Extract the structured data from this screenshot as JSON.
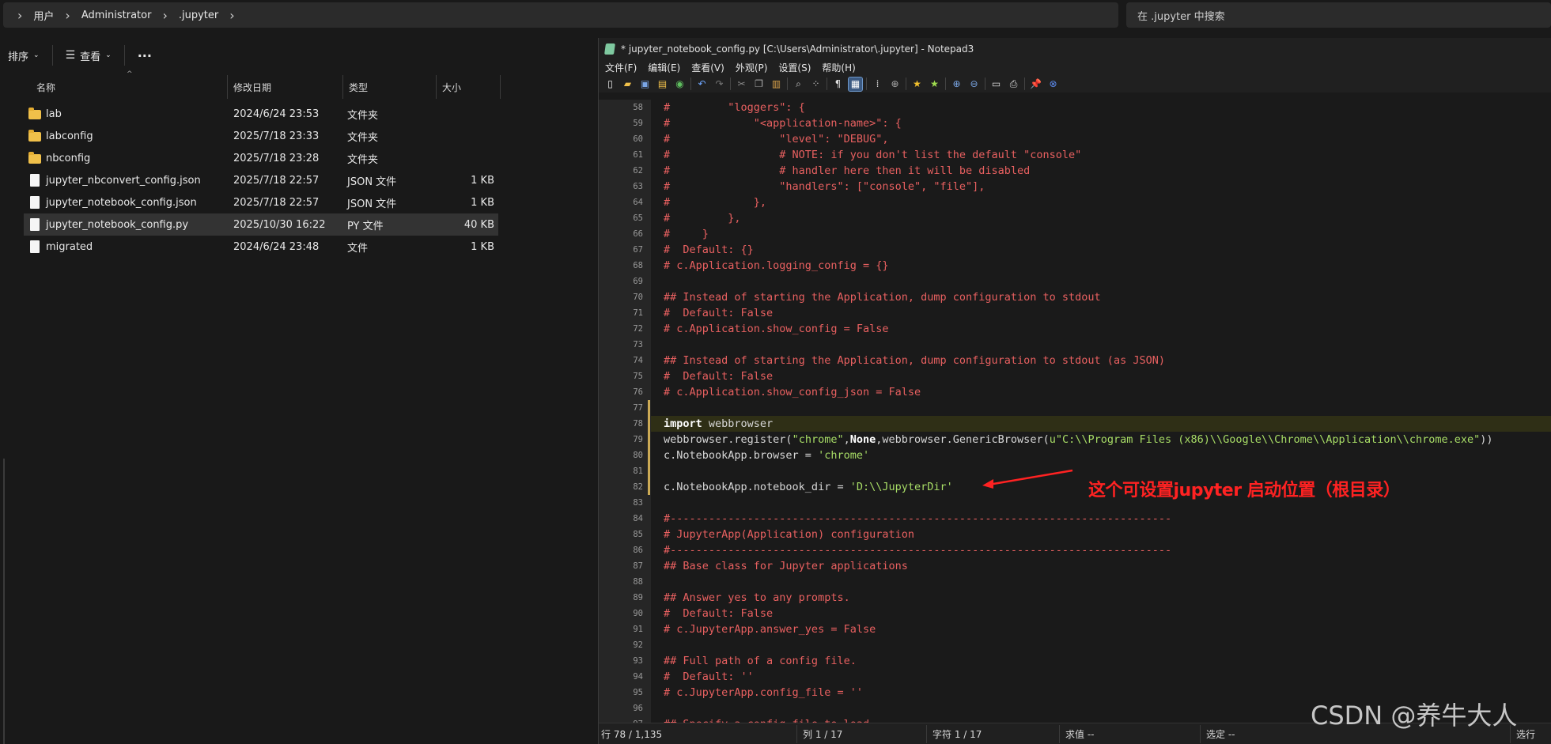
{
  "explorer": {
    "breadcrumbs": [
      "用户",
      "Administrator",
      ".jupyter"
    ],
    "search_placeholder": "在 .jupyter 中搜索",
    "commands": {
      "sort": "排序",
      "view": "查看",
      "more": "···"
    },
    "columns": {
      "name": "名称",
      "modified": "修改日期",
      "type": "类型",
      "size": "大小"
    },
    "files": [
      {
        "name": "lab",
        "modified": "2024/6/24 23:53",
        "type": "文件夹",
        "size": "",
        "icon": "folder-icon"
      },
      {
        "name": "labconfig",
        "modified": "2025/7/18 23:33",
        "type": "文件夹",
        "size": "",
        "icon": "folder-icon"
      },
      {
        "name": "nbconfig",
        "modified": "2025/7/18 23:28",
        "type": "文件夹",
        "size": "",
        "icon": "folder-icon"
      },
      {
        "name": "jupyter_nbconvert_config.json",
        "modified": "2025/7/18 22:57",
        "type": "JSON 文件",
        "size": "1 KB",
        "icon": "file-icon"
      },
      {
        "name": "jupyter_notebook_config.json",
        "modified": "2025/7/18 22:57",
        "type": "JSON 文件",
        "size": "1 KB",
        "icon": "file-icon"
      },
      {
        "name": "jupyter_notebook_config.py",
        "modified": "2025/10/30 16:22",
        "type": "PY 文件",
        "size": "40 KB",
        "icon": "file-icon",
        "selected": true
      },
      {
        "name": "migrated",
        "modified": "2024/6/24 23:48",
        "type": "文件",
        "size": "1 KB",
        "icon": "file-icon"
      }
    ]
  },
  "notepad": {
    "title": "* jupyter_notebook_config.py [C:\\Users\\Administrator\\.jupyter] - Notepad3",
    "menu": [
      "文件(F)",
      "编辑(E)",
      "查看(V)",
      "外观(P)",
      "设置(S)",
      "帮助(H)"
    ],
    "lines": [
      {
        "n": "58",
        "segs": [
          [
            "cm",
            "#         \"loggers\": {"
          ]
        ]
      },
      {
        "n": "59",
        "segs": [
          [
            "cm",
            "#             \"<application-name>\": {"
          ]
        ]
      },
      {
        "n": "60",
        "segs": [
          [
            "cm",
            "#                 \"level\": \"DEBUG\","
          ]
        ]
      },
      {
        "n": "61",
        "segs": [
          [
            "cm",
            "#                 # NOTE: if you don't list the default \"console\""
          ]
        ]
      },
      {
        "n": "62",
        "segs": [
          [
            "cm",
            "#                 # handler here then it will be disabled"
          ]
        ]
      },
      {
        "n": "63",
        "segs": [
          [
            "cm",
            "#                 \"handlers\": [\"console\", \"file\"],"
          ]
        ]
      },
      {
        "n": "64",
        "segs": [
          [
            "cm",
            "#             },"
          ]
        ]
      },
      {
        "n": "65",
        "segs": [
          [
            "cm",
            "#         },"
          ]
        ]
      },
      {
        "n": "66",
        "segs": [
          [
            "cm",
            "#     }"
          ]
        ]
      },
      {
        "n": "67",
        "segs": [
          [
            "cm",
            "#  Default: {}"
          ]
        ]
      },
      {
        "n": "68",
        "segs": [
          [
            "cm",
            "# c.Application.logging_config = {}"
          ]
        ]
      },
      {
        "n": "69",
        "segs": []
      },
      {
        "n": "70",
        "segs": [
          [
            "cm",
            "## Instead of starting the Application, dump configuration to stdout"
          ]
        ]
      },
      {
        "n": "71",
        "segs": [
          [
            "cm",
            "#  Default: False"
          ]
        ]
      },
      {
        "n": "72",
        "segs": [
          [
            "cm",
            "# c.Application.show_config = False"
          ]
        ]
      },
      {
        "n": "73",
        "segs": []
      },
      {
        "n": "74",
        "segs": [
          [
            "cm",
            "## Instead of starting the Application, dump configuration to stdout (as JSON)"
          ]
        ]
      },
      {
        "n": "75",
        "segs": [
          [
            "cm",
            "#  Default: False"
          ]
        ]
      },
      {
        "n": "76",
        "segs": [
          [
            "cm",
            "# c.Application.show_config_json = False"
          ]
        ]
      },
      {
        "n": "77",
        "segs": []
      },
      {
        "n": "78",
        "segs": [
          [
            "kw",
            "import"
          ],
          [
            "id",
            " webbrowser"
          ]
        ],
        "highlight": true
      },
      {
        "n": "79",
        "segs": [
          [
            "id",
            "webbrowser.register("
          ],
          [
            "str",
            "\"chrome\""
          ],
          [
            "id",
            ","
          ],
          [
            "kw",
            "None"
          ],
          [
            "id",
            ",webbrowser.GenericBrowser("
          ],
          [
            "str",
            "u\"C:\\\\Program Files (x86)\\\\Google\\\\Chrome\\\\Application\\\\chrome.exe\""
          ],
          [
            "id",
            "))"
          ]
        ]
      },
      {
        "n": "80",
        "segs": [
          [
            "id",
            "c.NotebookApp.browser = "
          ],
          [
            "str",
            "'chrome'"
          ]
        ]
      },
      {
        "n": "81",
        "segs": []
      },
      {
        "n": "82",
        "segs": [
          [
            "id",
            "c.NotebookApp.notebook_dir = "
          ],
          [
            "str",
            "'D:\\\\JupyterDir'"
          ]
        ]
      },
      {
        "n": "83",
        "segs": []
      },
      {
        "n": "84",
        "segs": [
          [
            "cm",
            "#------------------------------------------------------------------------------"
          ]
        ]
      },
      {
        "n": "85",
        "segs": [
          [
            "cm",
            "# JupyterApp(Application) configuration"
          ]
        ]
      },
      {
        "n": "86",
        "segs": [
          [
            "cm",
            "#------------------------------------------------------------------------------"
          ]
        ]
      },
      {
        "n": "87",
        "segs": [
          [
            "cm",
            "## Base class for Jupyter applications"
          ]
        ]
      },
      {
        "n": "88",
        "segs": []
      },
      {
        "n": "89",
        "segs": [
          [
            "cm",
            "## Answer yes to any prompts."
          ]
        ]
      },
      {
        "n": "90",
        "segs": [
          [
            "cm",
            "#  Default: False"
          ]
        ]
      },
      {
        "n": "91",
        "segs": [
          [
            "cm",
            "# c.JupyterApp.answer_yes = False"
          ]
        ]
      },
      {
        "n": "92",
        "segs": []
      },
      {
        "n": "93",
        "segs": [
          [
            "cm",
            "## Full path of a config file."
          ]
        ]
      },
      {
        "n": "94",
        "segs": [
          [
            "cm",
            "#  Default: ''"
          ]
        ]
      },
      {
        "n": "95",
        "segs": [
          [
            "cm",
            "# c.JupyterApp.config_file = ''"
          ]
        ]
      },
      {
        "n": "96",
        "segs": []
      },
      {
        "n": "97",
        "segs": [
          [
            "cm",
            "## Specify a config file to load."
          ]
        ]
      }
    ],
    "annotation": "这个可设置jupyter 启动位置（根目录）",
    "status": {
      "line": "行  78 / 1,135",
      "col": "列  1 / 17",
      "char": "字符  1 / 17",
      "sum": "求值  --",
      "sel": "选定  --",
      "sel2": "选行"
    }
  },
  "watermark": "CSDN @养牛大人",
  "colors": {
    "comment": "#e86060",
    "string": "#a8dd66",
    "annotation": "#ff2222"
  }
}
